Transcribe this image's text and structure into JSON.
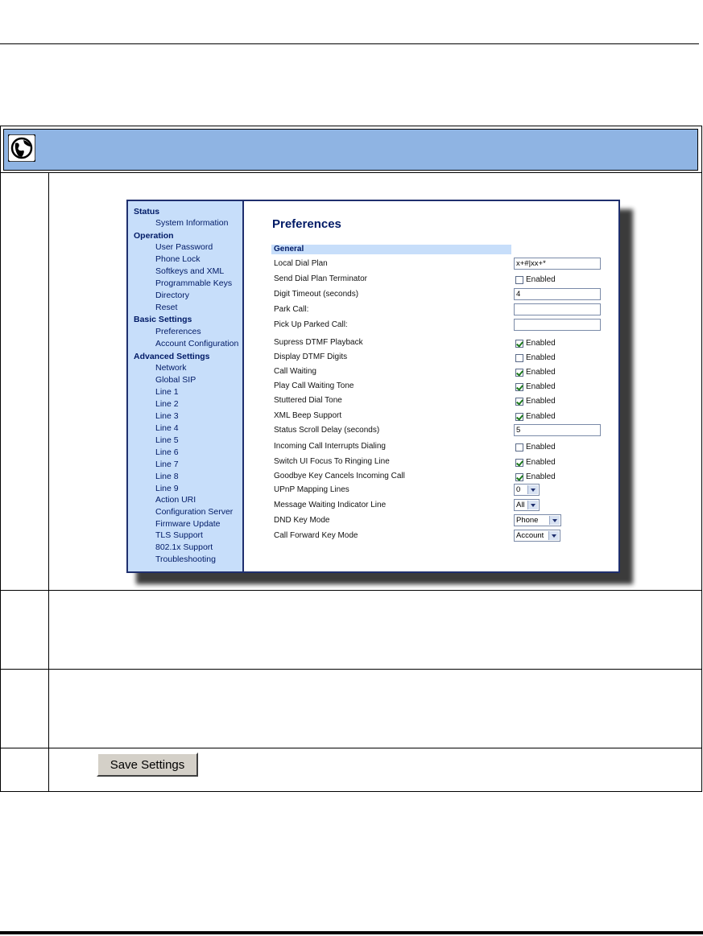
{
  "preferences_ui": {
    "page_title": "Preferences",
    "nav": [
      {
        "label": "Status",
        "type": "section"
      },
      {
        "label": "System Information",
        "type": "link"
      },
      {
        "label": "Operation",
        "type": "section"
      },
      {
        "label": "User Password",
        "type": "link"
      },
      {
        "label": "Phone Lock",
        "type": "link"
      },
      {
        "label": "Softkeys and XML",
        "type": "link"
      },
      {
        "label": "Programmable Keys",
        "type": "link"
      },
      {
        "label": "Directory",
        "type": "link"
      },
      {
        "label": "Reset",
        "type": "link"
      },
      {
        "label": "Basic Settings",
        "type": "section"
      },
      {
        "label": "Preferences",
        "type": "link"
      },
      {
        "label": "Account Configuration",
        "type": "link"
      },
      {
        "label": "Advanced Settings",
        "type": "section"
      },
      {
        "label": "Network",
        "type": "link"
      },
      {
        "label": "Global SIP",
        "type": "link"
      },
      {
        "label": "Line 1",
        "type": "link"
      },
      {
        "label": "Line 2",
        "type": "link"
      },
      {
        "label": "Line 3",
        "type": "link"
      },
      {
        "label": "Line 4",
        "type": "link"
      },
      {
        "label": "Line 5",
        "type": "link"
      },
      {
        "label": "Line 6",
        "type": "link"
      },
      {
        "label": "Line 7",
        "type": "link"
      },
      {
        "label": "Line 8",
        "type": "link"
      },
      {
        "label": "Line 9",
        "type": "link"
      },
      {
        "label": "Action URI",
        "type": "link"
      },
      {
        "label": "Configuration Server",
        "type": "link"
      },
      {
        "label": "Firmware Update",
        "type": "link"
      },
      {
        "label": "TLS Support",
        "type": "link"
      },
      {
        "label": "802.1x Support",
        "type": "link"
      },
      {
        "label": "Troubleshooting",
        "type": "link"
      }
    ],
    "section_label": "General",
    "fields": [
      {
        "label": "Local Dial Plan",
        "control": "text",
        "value": "x+#|xx+*"
      },
      {
        "label": "Send Dial Plan Terminator",
        "control": "checkbox",
        "checked": false,
        "option": "Enabled"
      },
      {
        "label": "Digit Timeout (seconds)",
        "control": "text",
        "value": "4"
      },
      {
        "label": "Park Call:",
        "control": "text",
        "value": ""
      },
      {
        "label": "Pick Up Parked Call:",
        "control": "text",
        "value": ""
      },
      {
        "label": "Supress DTMF Playback",
        "control": "checkbox",
        "checked": true,
        "option": "Enabled"
      },
      {
        "label": "Display DTMF Digits",
        "control": "checkbox",
        "checked": false,
        "option": "Enabled"
      },
      {
        "label": "Call Waiting",
        "control": "checkbox",
        "checked": true,
        "option": "Enabled"
      },
      {
        "label": "Play Call Waiting Tone",
        "control": "checkbox",
        "checked": true,
        "option": "Enabled"
      },
      {
        "label": "Stuttered Dial Tone",
        "control": "checkbox",
        "checked": true,
        "option": "Enabled"
      },
      {
        "label": "XML Beep Support",
        "control": "checkbox",
        "checked": true,
        "option": "Enabled"
      },
      {
        "label": "Status Scroll Delay (seconds)",
        "control": "text",
        "value": "5"
      },
      {
        "label": "Incoming Call Interrupts Dialing",
        "control": "checkbox",
        "checked": false,
        "option": "Enabled"
      },
      {
        "label": "Switch UI Focus To Ringing Line",
        "control": "checkbox",
        "checked": true,
        "option": "Enabled"
      },
      {
        "label": "Goodbye Key Cancels Incoming Call",
        "control": "checkbox",
        "checked": true,
        "option": "Enabled"
      },
      {
        "label": "UPnP Mapping Lines",
        "control": "select",
        "value": "0"
      },
      {
        "label": "Message Waiting Indicator Line",
        "control": "select",
        "value": "All"
      },
      {
        "label": "DND Key Mode",
        "control": "select",
        "value": "Phone"
      },
      {
        "label": "Call Forward Key Mode",
        "control": "select",
        "value": "Account"
      }
    ]
  },
  "save_button_label": "Save Settings",
  "icons": {
    "header": "globe-icon"
  },
  "colors": {
    "header_band": "#8fb4e3",
    "nav_background": "#c7defa",
    "nav_text": "#001a66"
  }
}
